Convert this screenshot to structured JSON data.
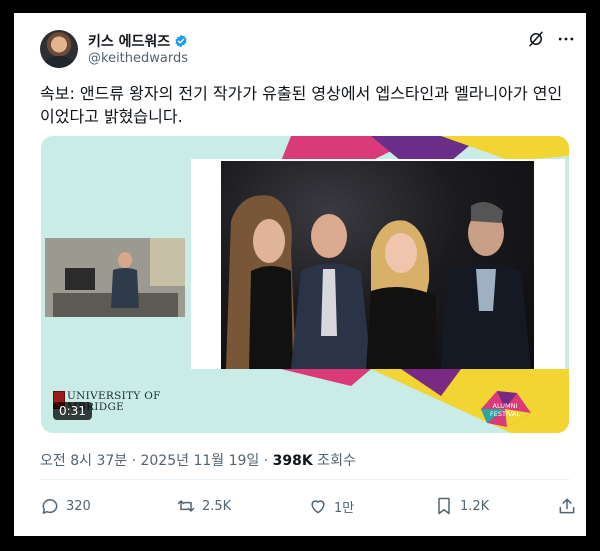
{
  "author": {
    "display_name": "키스 에드워즈",
    "handle": "@keithedwards"
  },
  "tweet": {
    "text": "속보: 앤드류 왕자의 전기 작가가 유출된 영상에서 엡스타인과 멜라니아가 연인이었다고 밝혔습니다."
  },
  "media": {
    "duration": "0:31",
    "logo_line1": "UNIVERSITY OF",
    "logo_line2": "MBRIDGE",
    "festival_line1": "ALUMNI",
    "festival_line2": "FESTIVAL"
  },
  "meta": {
    "timestamp": "오전 8시 37분 · 2025년 11월 19일 · ",
    "views_count": "398K",
    "views_label": " 조회수"
  },
  "actions": {
    "replies": "320",
    "reposts": "2.5K",
    "likes": "1만",
    "bookmarks": "1.2K"
  },
  "colors": {
    "verified": "#1d9bf0",
    "media_bg": "#c9ece6",
    "accent_yellow": "#f2d432",
    "accent_purple": "#7a2a82",
    "accent_pink": "#d83a7a"
  }
}
